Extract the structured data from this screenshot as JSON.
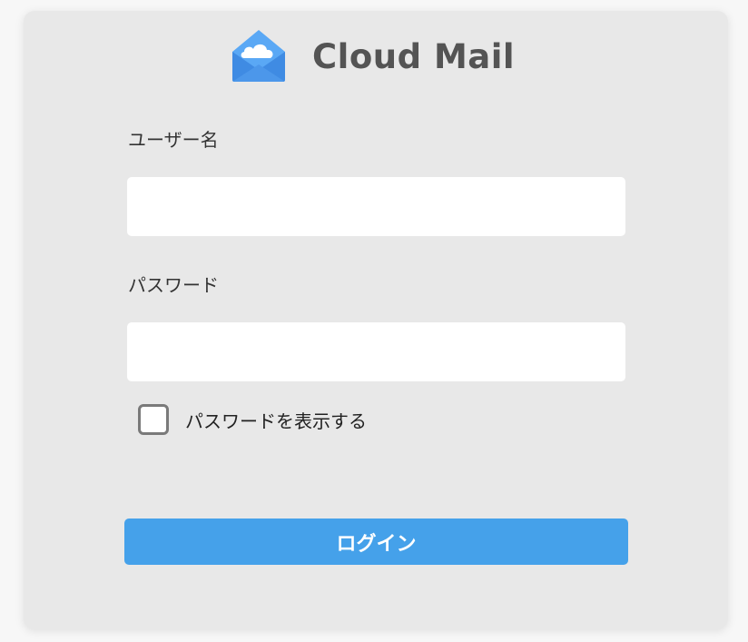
{
  "app": {
    "name": "Cloud Mail",
    "logo_icon": "envelope-cloud-icon",
    "colors": {
      "accent": "#45a1ea",
      "card_background": "#e8e8e8",
      "page_background": "#f7f7f7",
      "logo_text": "#545454"
    }
  },
  "form": {
    "username_label": "ユーザー名",
    "username_value": "",
    "password_label": "パスワード",
    "password_value": "",
    "show_password_label": "パスワードを表示する",
    "show_password_checked": false,
    "login_label": "ログイン"
  }
}
